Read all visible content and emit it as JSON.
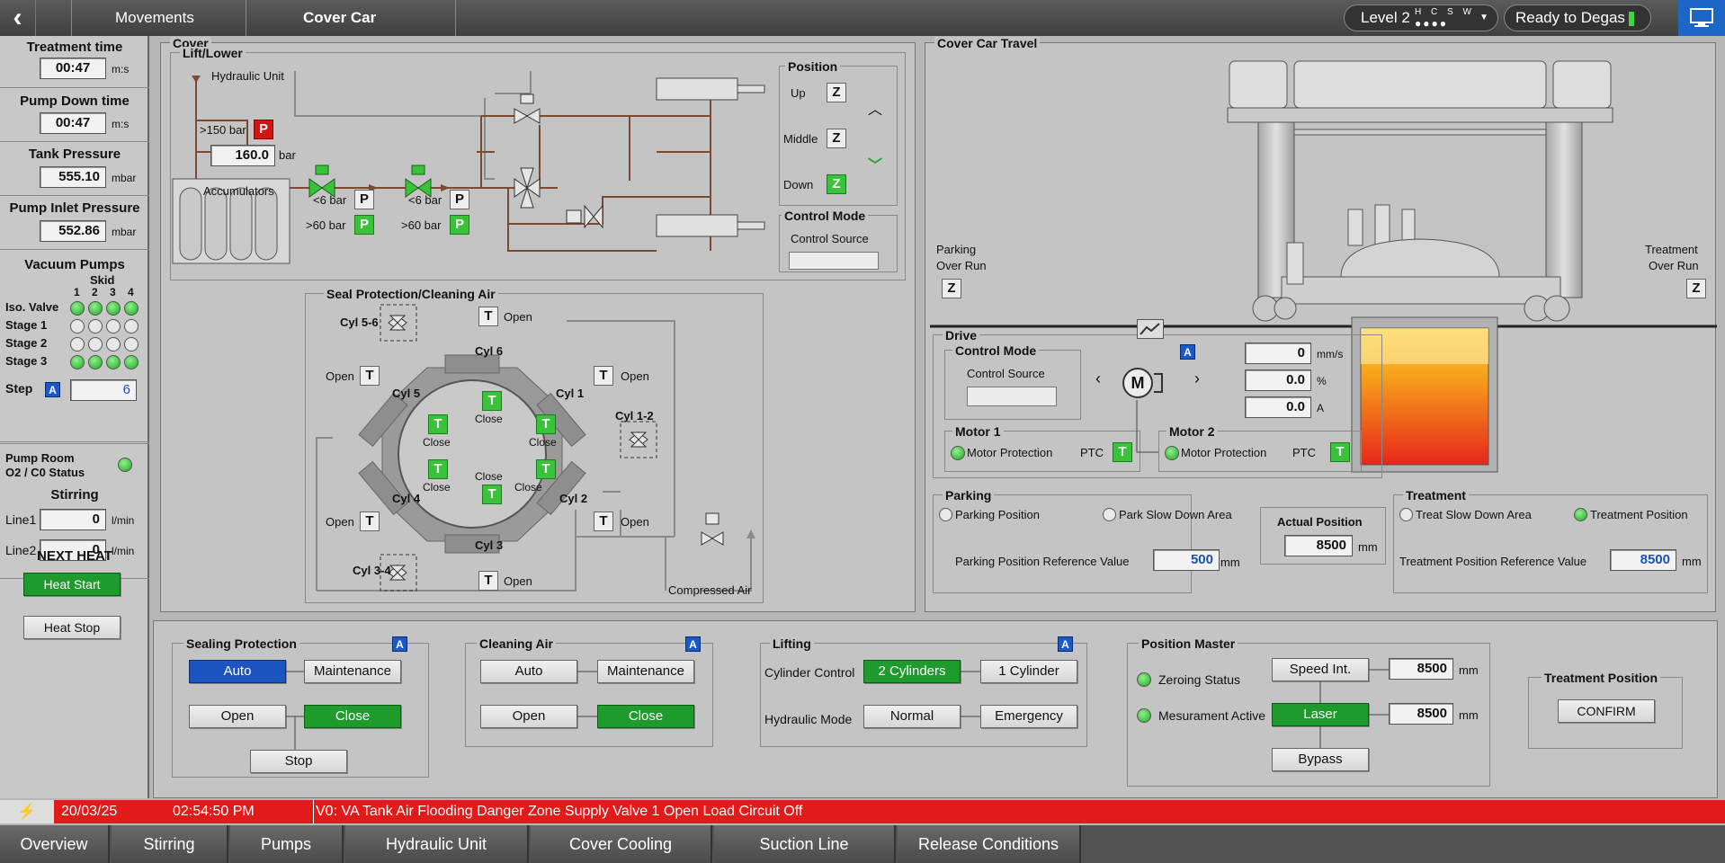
{
  "header": {
    "back_icon": "back-arrow-icon",
    "breadcrumb": [
      "Movements",
      "Cover Car"
    ],
    "level": {
      "label": "Level 2",
      "hcsw": "H C S W",
      "dots": "●●●●"
    },
    "status": "Ready to Degas",
    "monitor_icon": "monitor-icon"
  },
  "left": {
    "treatment_time": {
      "label": "Treatment time",
      "value": "00:47",
      "unit": "m:s"
    },
    "pump_down_time": {
      "label": "Pump Down time",
      "value": "00:47",
      "unit": "m:s"
    },
    "tank_pressure": {
      "label": "Tank Pressure",
      "value": "555.10",
      "unit": "mbar"
    },
    "pump_inlet_pressure": {
      "label": "Pump Inlet Pressure",
      "value": "552.86",
      "unit": "mbar"
    },
    "vacuum_pumps": {
      "title": "Vacuum Pumps",
      "skid_label": "Skid",
      "skids": [
        "1",
        "2",
        "3",
        "4"
      ],
      "rows": [
        {
          "label": "Iso. Valve",
          "states": [
            true,
            true,
            true,
            true
          ]
        },
        {
          "label": "Stage 1",
          "states": [
            false,
            false,
            false,
            false
          ]
        },
        {
          "label": "Stage 2",
          "states": [
            false,
            false,
            false,
            false
          ]
        },
        {
          "label": "Stage 3",
          "states": [
            true,
            true,
            true,
            true
          ]
        }
      ],
      "step_label": "Step",
      "step_badge": "A",
      "step_value": "6"
    },
    "pump_room": {
      "label1": "Pump Room",
      "label2": "O2 / C0 Status"
    },
    "stirring": {
      "title": "Stirring",
      "line1_label": "Line1",
      "line1_value": "0",
      "line2_label": "Line2",
      "line2_value": "0",
      "unit": "l/min"
    },
    "next_heat": {
      "title": "NEXT HEAT",
      "start": "Heat Start",
      "stop": "Heat Stop"
    }
  },
  "cover": {
    "title": "Cover",
    "lift_lower": "Lift/Lower",
    "hydraulic_unit": "Hydraulic Unit",
    "pressure_high_label": ">150 bar",
    "p_badge": "P",
    "pressure_value": "160.0",
    "pressure_unit": "bar",
    "accumulators": "Accumulators",
    "lt6": "<6 bar",
    "gt60": ">60 bar",
    "position": {
      "title": "Position",
      "up": "Up",
      "middle": "Middle",
      "down": "Down",
      "z": "Z"
    },
    "control_mode": {
      "title": "Control Mode",
      "source": "Control Source"
    },
    "seal": {
      "title": "Seal Protection/Cleaning Air",
      "t": "T",
      "open": "Open",
      "close": "Close",
      "cyl_5_6": "Cyl 5-6",
      "cyl_1_2": "Cyl 1-2",
      "cyl_3_4": "Cyl 3-4",
      "cyl6": "Cyl 6",
      "cyl5": "Cyl 5",
      "cyl1": "Cyl 1",
      "cyl4": "Cyl 4",
      "cyl2": "Cyl 2",
      "cyl3": "Cyl 3",
      "compressed_air": "Compressed Air"
    }
  },
  "travel": {
    "title": "Cover Car Travel",
    "parking_over_run": [
      "Parking",
      "Over Run"
    ],
    "treatment_over_run": [
      "Treatment",
      "Over Run"
    ],
    "z": "Z",
    "drive": {
      "title": "Drive",
      "control_mode": "Control Mode",
      "control_source": "Control Source",
      "a_badge": "A",
      "motor_symbol": "M",
      "speed": {
        "value": "0",
        "unit": "mm/s"
      },
      "percent": {
        "value": "0.0",
        "unit": "%"
      },
      "current": {
        "value": "0.0",
        "unit": "A"
      },
      "motor1": {
        "title": "Motor 1",
        "protection": "Motor Protection",
        "ptc": "PTC",
        "t": "T"
      },
      "motor2": {
        "title": "Motor 2",
        "protection": "Motor Protection",
        "ptc": "PTC",
        "t": "T"
      }
    },
    "parking": {
      "title": "Parking",
      "parking_position": "Parking Position",
      "slow_down": "Park Slow Down Area",
      "ref_label": "Parking Position Reference Value",
      "ref_value": "500",
      "unit": "mm"
    },
    "actual": {
      "title": "Actual Position",
      "value": "8500",
      "unit": "mm"
    },
    "treatment": {
      "title": "Treatment",
      "slow_down": "Treat Slow Down Area",
      "position": "Treatment Position",
      "ref_label": "Treatment Position Reference Value",
      "ref_value": "8500",
      "unit": "mm"
    }
  },
  "controls": {
    "sealing": {
      "title": "Sealing Protection",
      "badge": "A",
      "auto": "Auto",
      "maintenance": "Maintenance",
      "open": "Open",
      "close": "Close",
      "stop": "Stop"
    },
    "cleaning": {
      "title": "Cleaning Air",
      "badge": "A",
      "auto": "Auto",
      "maintenance": "Maintenance",
      "open": "Open",
      "close": "Close"
    },
    "lifting": {
      "title": "Lifting",
      "badge": "A",
      "cyl_control": "Cylinder Control",
      "two_cyl": "2 Cylinders",
      "one_cyl": "1 Cylinder",
      "hyd_mode": "Hydraulic Mode",
      "normal": "Normal",
      "emergency": "Emergency"
    },
    "position_master": {
      "title": "Position Master",
      "zeroing": "Zeroing Status",
      "measurement": "Mesurament Active",
      "speed_int": "Speed Int.",
      "laser": "Laser",
      "bypass": "Bypass",
      "value1": "8500",
      "value2": "8500",
      "unit": "mm"
    },
    "treatment_position": {
      "title": "Treatment Position",
      "confirm": "CONFIRM"
    }
  },
  "alarm": {
    "date": "20/03/25",
    "time": "02:54:50 PM",
    "message": "V0: VA Tank Air Flooding Danger Zone Supply Valve 1 Open Load Circuit Off"
  },
  "nav": [
    "Overview",
    "Stirring",
    "Pumps",
    "Hydraulic Unit",
    "Cover Cooling",
    "Suction Line",
    "Release Conditions"
  ],
  "colors": {
    "accent_green": "#1f9a2c",
    "accent_blue": "#1c55c0",
    "alarm_red": "#e11a1a"
  }
}
